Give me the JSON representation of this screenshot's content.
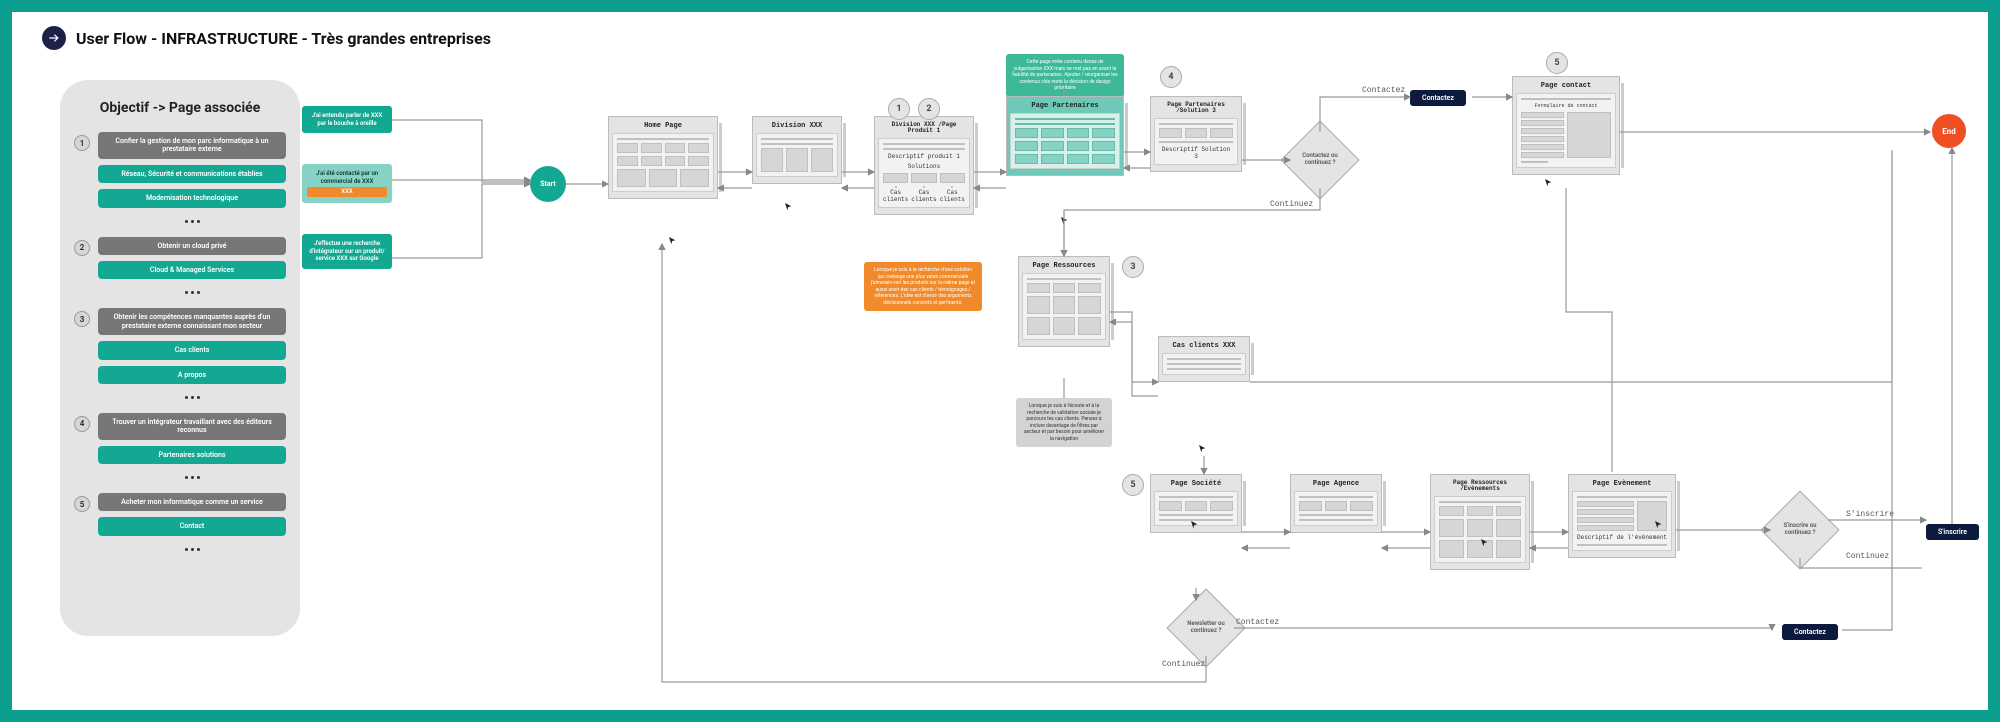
{
  "title": "User Flow - INFRASTRUCTURE - Très grandes entreprises",
  "sidebar_title": "Objectif -> Page associée",
  "sidebar": [
    {
      "num": "1",
      "gray": "Confier la gestion de mon parc informatique à un prestataire externe",
      "teal": [
        "Réseau, Sécurité et communications établies",
        "Modernisation technologique"
      ]
    },
    {
      "num": "2",
      "gray": "Obtenir un cloud privé",
      "teal": [
        "Cloud & Managed Services"
      ]
    },
    {
      "num": "3",
      "gray": "Obtenir les compétences manquantes auprès d'un prestataire externe connaissant mon secteur",
      "teal": [
        "Cas clients",
        "A propos"
      ]
    },
    {
      "num": "4",
      "gray": "Trouver un intégrateur travaillant avec des éditeurs reconnus",
      "teal": [
        "Partenaires solutions"
      ]
    },
    {
      "num": "5",
      "gray": "Acheter mon informatique comme un service",
      "teal": [
        "Contact"
      ]
    }
  ],
  "entries": [
    {
      "text": "J'ai entendu parler de XXX par le bouche à oreille"
    },
    {
      "text": "J'ai été contacté par un commercial de XXX",
      "orange": true
    },
    {
      "text": "J'effectue une recherche d'intégrateur sur un produit/ service XXX sur Google"
    }
  ],
  "start": "Start",
  "end": "End",
  "pages": {
    "home": {
      "title": "Home Page"
    },
    "division": {
      "title": "Division XXX"
    },
    "division_prod": {
      "title": "Division XXX /Page Produit 1",
      "descriptif": "Descriptif produit 1",
      "solutions": "Solutions",
      "cas_client": "Cas clients"
    },
    "partenaires": {
      "title": "Page Partenaires"
    },
    "partenaires_sol": {
      "title": "Page Partenaires /Solution 3",
      "descriptif": "Descriptif Solution 3"
    },
    "ressources": {
      "title": "Page Ressources"
    },
    "cas_clients": {
      "title": "Cas clients XXX"
    },
    "societe": {
      "title": "Page Société"
    },
    "agence": {
      "title": "Page Agence"
    },
    "ressources_evt": {
      "title": "Page Ressources /Evènements"
    },
    "evenement": {
      "title": "Page Evènement",
      "descriptif": "Descriptif de l'évènement"
    },
    "contact": {
      "title": "Page contact",
      "form_label": "Formulaire de contact"
    }
  },
  "notes": {
    "green_top": "Cette page mêle contenu dense de vulgarisation XXX mais ne met pas en avant la fiabilité de partenaires. Ajouter / réorganiser les contenus clés reste la décision de design prioritaire",
    "orange": "Lorsque je suis à la recherche d'une solution qui mélange une plus value commerciale j'aimerais voir les produits sur la même page et aussi avoir des cas clients / témoignages / références. L'idée est d'avoir des arguments décisionnels concrets et pertinents.",
    "gray": "Lorsque je suis à l'écoute et à la recherche de validation sociale je parcours les cas clients. Pensez à inclure davantage de filtres par secteur et par besoin pour améliorer la navigation"
  },
  "diamonds": {
    "d1": "Contactez ou continuez ?",
    "d2": "Newsletter ou continuez ?",
    "d3": "S'inscrire ou continuez ?"
  },
  "edge_labels": {
    "contactez1": "Contactez",
    "continuez1": "Continuez",
    "contactez2": "Contactez",
    "continuez2": "Continuez",
    "sinscrire": "S'inscrire",
    "continuez3": "Continuez"
  },
  "ctas": {
    "contactez": "Contactez",
    "sinscrire": "S'inscrire",
    "contactez2": "Contactez"
  },
  "tags": {
    "t1": "1",
    "t2": "2",
    "t3": "3",
    "t4": "4",
    "t5": "5",
    "t5b": "5"
  }
}
